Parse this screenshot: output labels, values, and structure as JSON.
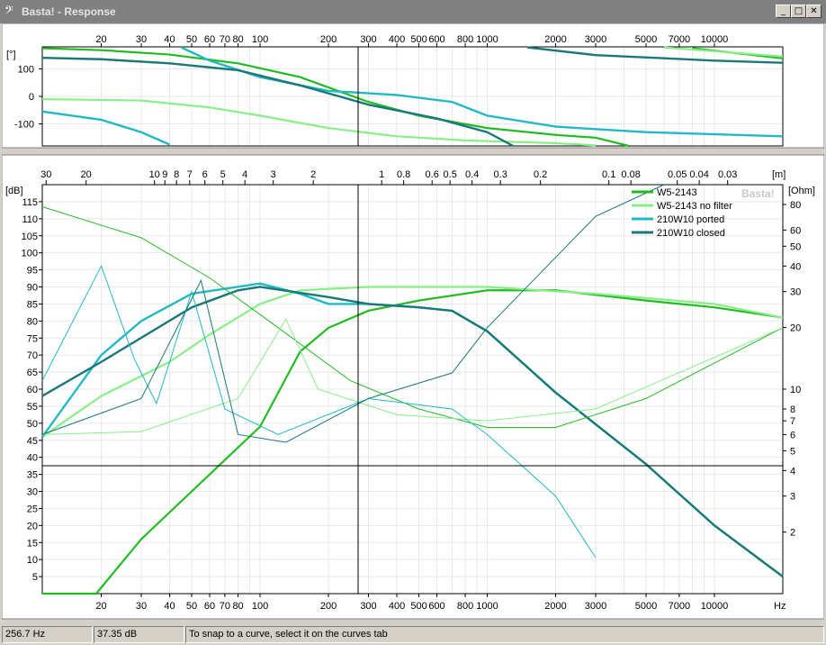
{
  "window": {
    "app_icon": "bass-clef-icon",
    "title": "Basta! - Response",
    "controls": {
      "minimize": "_",
      "maximize": "□",
      "close": "✕"
    }
  },
  "phase_chart": {
    "y_label": "[°]",
    "y_ticks": [
      "100",
      "0",
      "-100"
    ],
    "x_ticks": [
      "20",
      "30",
      "40",
      "50",
      "60",
      "70",
      "80",
      "100",
      "200",
      "300",
      "400",
      "500",
      "600",
      "800",
      "1000",
      "2000",
      "3000",
      "5000",
      "7000",
      "10000"
    ]
  },
  "response_chart": {
    "y_label": "[dB]",
    "y2_label": "[Ohm]",
    "top_axis_label": "[m]",
    "x_unit": "Hz",
    "watermark": "Basta!",
    "y_ticks": [
      "115",
      "110",
      "105",
      "100",
      "95",
      "90",
      "85",
      "80",
      "75",
      "70",
      "65",
      "60",
      "55",
      "50",
      "45",
      "40",
      "35",
      "30",
      "25",
      "20",
      "15",
      "10",
      "5"
    ],
    "ohm_ticks": [
      "80",
      "60",
      "50",
      "40",
      "30",
      "20",
      "10",
      "8",
      "7",
      "6",
      "5",
      "4",
      "3",
      "2"
    ],
    "top_ticks": [
      "30",
      "20",
      "10",
      "9",
      "8",
      "7",
      "6",
      "5",
      "4",
      "3",
      "2",
      "1",
      "0.8",
      "0.6",
      "0.5",
      "0.4",
      "0.3",
      "0.2",
      "0.1",
      "0.08",
      "0.05",
      "0.04",
      "0.03"
    ],
    "x_ticks": [
      "20",
      "30",
      "40",
      "50",
      "60",
      "70",
      "80",
      "100",
      "200",
      "300",
      "400",
      "500",
      "600",
      "800",
      "1000",
      "2000",
      "3000",
      "5000",
      "7000",
      "10000"
    ]
  },
  "legend": [
    {
      "label": "W5-2143",
      "color": "#22bb22"
    },
    {
      "label": "W5-2143 no filter",
      "color": "#88ee88"
    },
    {
      "label": "210W10 ported",
      "color": "#22b8c4"
    },
    {
      "label": "210W10 closed",
      "color": "#1a7878"
    }
  ],
  "chart_data": [
    {
      "type": "line",
      "x_scale": "log",
      "xlim": [
        11,
        20000
      ],
      "ylim": [
        -180,
        180
      ],
      "series": [
        {
          "name": "W5-2143",
          "color": "#22bb22",
          "points": [
            [
              11,
              175
            ],
            [
              20,
              168
            ],
            [
              40,
              152
            ],
            [
              80,
              120
            ],
            [
              150,
              70
            ],
            [
              300,
              -20
            ],
            [
              500,
              -70
            ],
            [
              1000,
              -115
            ],
            [
              2000,
              -140
            ],
            [
              3000,
              -150
            ],
            [
              4200,
              -180
            ],
            [
              8000,
              175
            ],
            [
              20000,
              138
            ]
          ]
        },
        {
          "name": "W5-2143 no filter",
          "color": "#88ee88",
          "points": [
            [
              11,
              -10
            ],
            [
              30,
              -15
            ],
            [
              60,
              -40
            ],
            [
              100,
              -70
            ],
            [
              200,
              -115
            ],
            [
              400,
              -145
            ],
            [
              800,
              -160
            ],
            [
              2000,
              -170
            ],
            [
              3000,
              -178
            ],
            [
              6000,
              178
            ],
            [
              20000,
              145
            ]
          ]
        },
        {
          "name": "210W10 ported",
          "color": "#22b8c4",
          "points": [
            [
              11,
              -55
            ],
            [
              20,
              -85
            ],
            [
              30,
              -130
            ],
            [
              40,
              -175
            ],
            [
              45,
              178
            ],
            [
              60,
              130
            ],
            [
              100,
              70
            ],
            [
              200,
              20
            ],
            [
              400,
              5
            ],
            [
              700,
              -20
            ],
            [
              1000,
              -70
            ],
            [
              2000,
              -110
            ],
            [
              5000,
              -130
            ],
            [
              20000,
              -145
            ]
          ]
        },
        {
          "name": "210W10 closed",
          "color": "#1a7878",
          "points": [
            [
              11,
              140
            ],
            [
              20,
              135
            ],
            [
              40,
              120
            ],
            [
              80,
              95
            ],
            [
              150,
              40
            ],
            [
              300,
              -30
            ],
            [
              600,
              -80
            ],
            [
              1000,
              -130
            ],
            [
              1300,
              -180
            ],
            [
              1500,
              178
            ],
            [
              3000,
              150
            ],
            [
              10000,
              130
            ],
            [
              20000,
              122
            ]
          ]
        }
      ]
    },
    {
      "type": "line",
      "x_scale": "log",
      "xlim": [
        11,
        20000
      ],
      "ylim": [
        0,
        120
      ],
      "y2_scale": "log",
      "y2lim": [
        1,
        100
      ],
      "series": [
        {
          "name": "W5-2143",
          "color": "#22bb22",
          "points": [
            [
              11,
              0
            ],
            [
              19,
              0
            ],
            [
              30,
              16
            ],
            [
              50,
              30
            ],
            [
              100,
              49
            ],
            [
              150,
              71
            ],
            [
              200,
              78
            ],
            [
              300,
              83
            ],
            [
              500,
              86
            ],
            [
              1000,
              89
            ],
            [
              2000,
              89
            ],
            [
              5000,
              86
            ],
            [
              10000,
              84
            ],
            [
              20000,
              81
            ]
          ]
        },
        {
          "name": "W5-2143 no filter",
          "color": "#88ee88",
          "points": [
            [
              11,
              46
            ],
            [
              20,
              58
            ],
            [
              40,
              68
            ],
            [
              60,
              76
            ],
            [
              100,
              85
            ],
            [
              150,
              89
            ],
            [
              300,
              90
            ],
            [
              1000,
              90
            ],
            [
              3000,
              88
            ],
            [
              10000,
              85
            ],
            [
              20000,
              81
            ]
          ]
        },
        {
          "name": "210W10 ported",
          "color": "#22b8c4",
          "points": [
            [
              11,
              46
            ],
            [
              20,
              70
            ],
            [
              30,
              80
            ],
            [
              50,
              88
            ],
            [
              100,
              91
            ],
            [
              150,
              88
            ],
            [
              200,
              85
            ],
            [
              300,
              85
            ],
            [
              500,
              84
            ],
            [
              700,
              83
            ],
            [
              1000,
              77
            ],
            [
              2000,
              59
            ],
            [
              5000,
              38
            ],
            [
              10000,
              20
            ],
            [
              20000,
              5
            ]
          ]
        },
        {
          "name": "210W10 closed",
          "color": "#1a7878",
          "points": [
            [
              11,
              58
            ],
            [
              20,
              68
            ],
            [
              50,
              84
            ],
            [
              80,
              89
            ],
            [
              100,
              90
            ],
            [
              200,
              87
            ],
            [
              300,
              85
            ],
            [
              500,
              84
            ],
            [
              700,
              83
            ],
            [
              1000,
              77
            ],
            [
              2000,
              59
            ],
            [
              5000,
              38
            ],
            [
              10000,
              20
            ],
            [
              20000,
              5
            ]
          ]
        }
      ]
    }
  ],
  "status": {
    "frequency": "256.7 Hz",
    "level": "37.35 dB",
    "hint": "To snap to a curve, select it on the curves tab"
  }
}
